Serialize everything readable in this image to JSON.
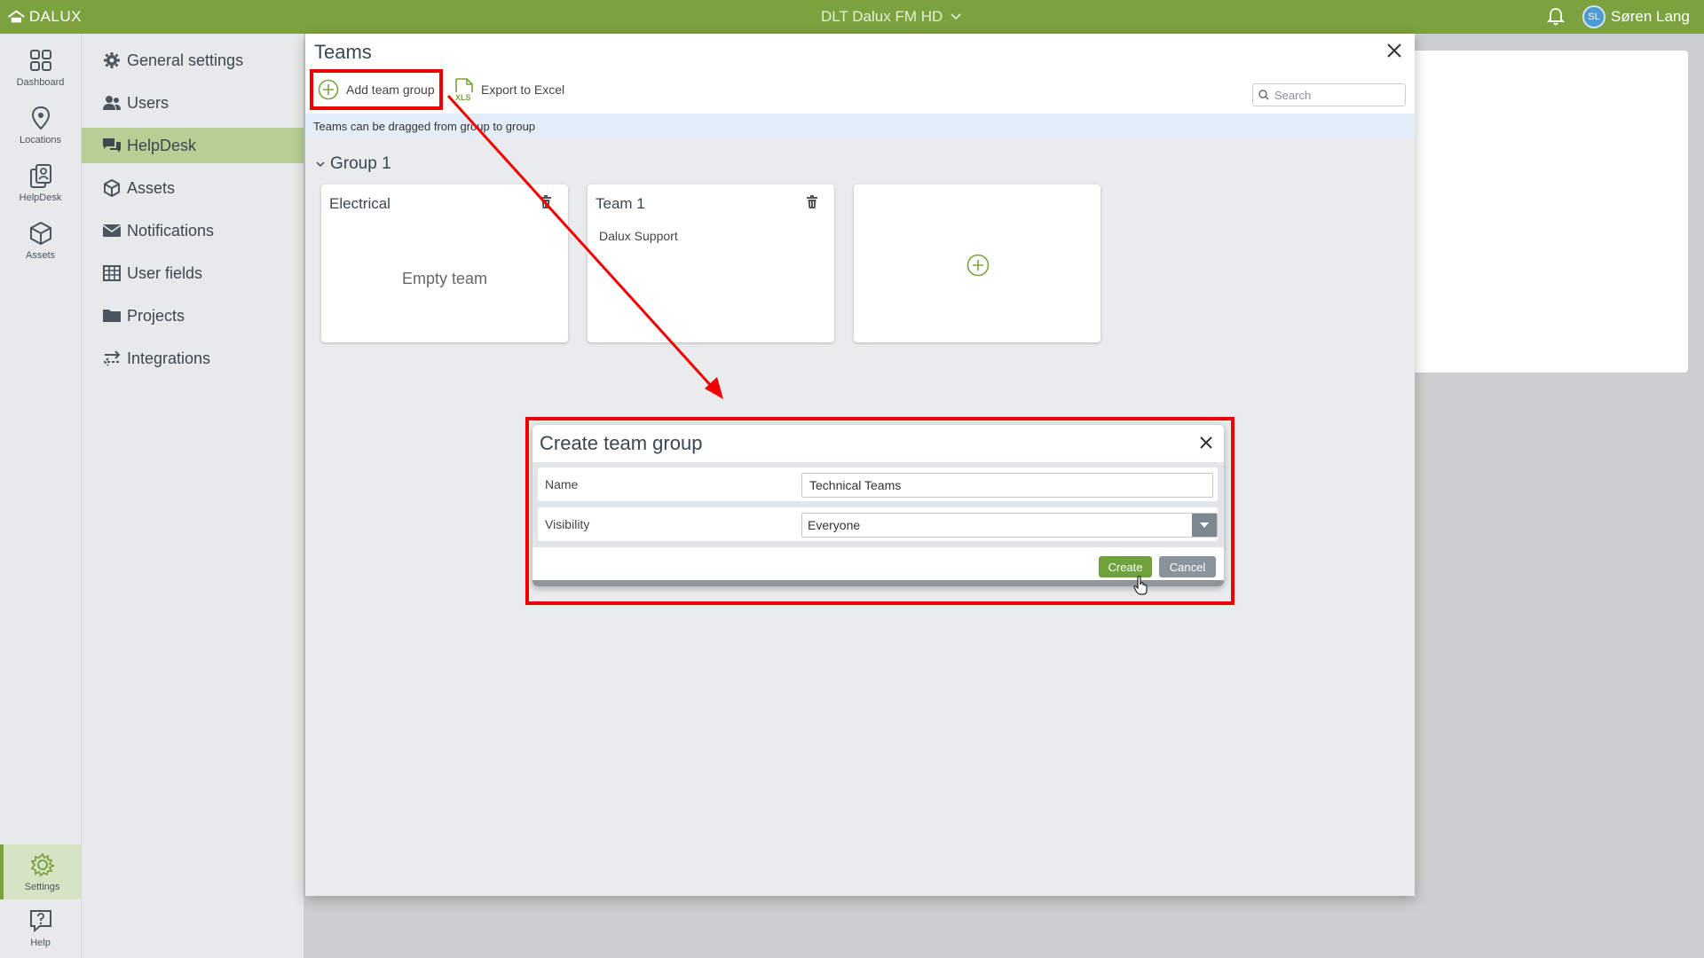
{
  "topbar": {
    "logo_text": "DALUX",
    "project_name": "DLT Dalux FM HD",
    "user_initials": "SL",
    "user_name": "Søren Lang"
  },
  "rail": {
    "items": [
      {
        "label": "Dashboard",
        "icon": "dashboard-icon"
      },
      {
        "label": "Locations",
        "icon": "location-pin-icon"
      },
      {
        "label": "HelpDesk",
        "icon": "helpdesk-icon"
      },
      {
        "label": "Assets",
        "icon": "cube-icon"
      },
      {
        "label": "Settings",
        "icon": "gear-icon"
      },
      {
        "label": "Help",
        "icon": "help-icon"
      }
    ]
  },
  "nav": {
    "items": [
      {
        "label": "General settings",
        "icon": "gear-icon"
      },
      {
        "label": "Users",
        "icon": "users-icon"
      },
      {
        "label": "HelpDesk",
        "icon": "chat-icon"
      },
      {
        "label": "Assets",
        "icon": "cube-icon"
      },
      {
        "label": "Notifications",
        "icon": "envelope-icon"
      },
      {
        "label": "User fields",
        "icon": "table-icon"
      },
      {
        "label": "Projects",
        "icon": "folder-icon"
      },
      {
        "label": "Integrations",
        "icon": "exchange-icon"
      }
    ]
  },
  "teams": {
    "title": "Teams",
    "add_group_label": "Add team group",
    "export_label": "Export to Excel",
    "search_placeholder": "Search",
    "hint": "Teams can be dragged from group to group",
    "group_title": "Group 1",
    "cards": [
      {
        "title": "Electrical",
        "empty_text": "Empty team"
      },
      {
        "title": "Team 1",
        "member": "Dalux Support"
      }
    ]
  },
  "dialog": {
    "title": "Create team group",
    "name_label": "Name",
    "name_value": "Technical Teams",
    "visibility_label": "Visibility",
    "visibility_value": "Everyone",
    "create_label": "Create",
    "cancel_label": "Cancel"
  },
  "colors": {
    "brand_green": "#7ba23f",
    "highlight_red": "#e00000",
    "create_button": "#6fa23a"
  }
}
